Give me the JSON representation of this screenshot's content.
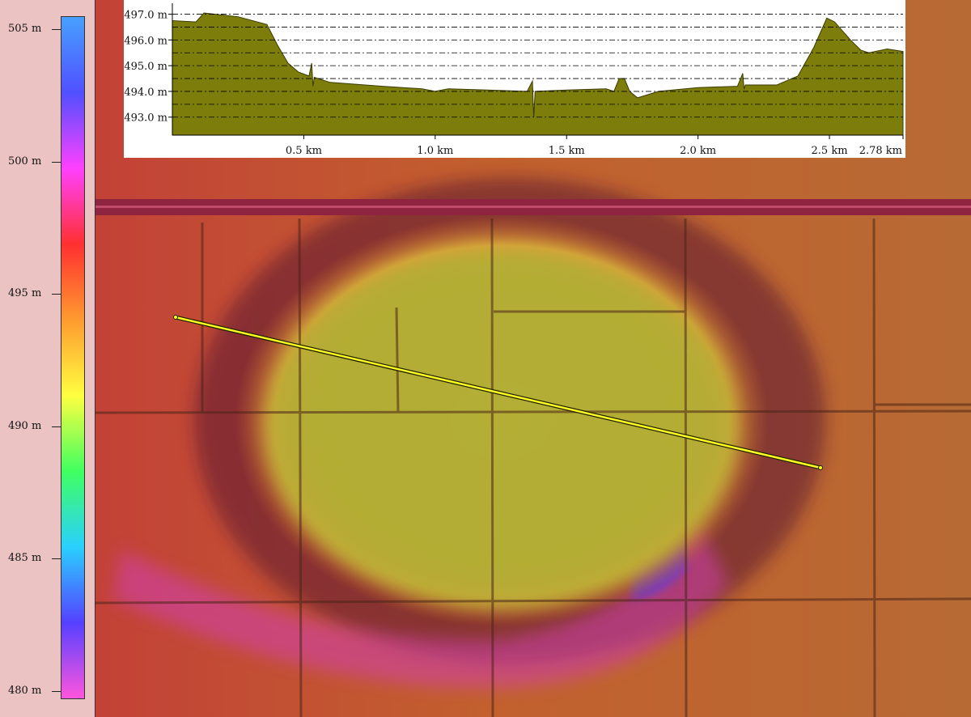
{
  "legend": {
    "labels": [
      "505 m",
      "500 m",
      "495 m",
      "490 m",
      "485 m",
      "480 m"
    ],
    "values": [
      505,
      500,
      495,
      490,
      485,
      480
    ],
    "range": [
      480,
      505
    ],
    "color_stops": [
      "#ff55dd",
      "#5540ff",
      "#2ad0ff",
      "#40ff60",
      "#ffff40",
      "#ff9a30",
      "#ff3030",
      "#ff40ff",
      "#5050ff",
      "#48a0ff"
    ]
  },
  "profile": {
    "y_tick_labels": [
      "497.0 m",
      "496.0 m",
      "495.0 m",
      "494.0 m",
      "493.0 m"
    ],
    "x_tick_labels": [
      "0.5 km",
      "1.0 km",
      "1.5 km",
      "2.0 km",
      "2.5 km",
      "2.78 km"
    ],
    "fill_color": "#7d7d0c"
  },
  "chart_data": {
    "type": "area",
    "title": "",
    "xlabel": "",
    "ylabel": "",
    "x_unit": "km",
    "y_unit": "m",
    "xlim": [
      0,
      2.78
    ],
    "ylim": [
      492.3,
      497.3
    ],
    "x_ticks": [
      0.5,
      1.0,
      1.5,
      2.0,
      2.5,
      2.78
    ],
    "y_ticks": [
      497.0,
      496.0,
      495.0,
      494.0,
      493.0
    ],
    "grid": true,
    "series": [
      {
        "x": [
          0,
          0.09,
          0.12,
          0.25,
          0.36,
          0.4,
          0.44,
          0.48,
          0.52,
          0.53,
          0.535,
          0.54,
          0.6,
          0.8,
          0.95,
          1.0,
          1.05,
          1.2,
          1.35,
          1.37,
          1.375,
          1.38,
          1.5,
          1.65,
          1.68,
          1.7,
          1.72,
          1.74,
          1.77,
          1.85,
          2.0,
          2.15,
          2.17,
          2.175,
          2.18,
          2.3,
          2.38,
          2.44,
          2.49,
          2.52,
          2.58,
          2.62,
          2.65,
          2.72,
          2.78
        ],
        "y": [
          496.75,
          496.7,
          497.05,
          496.9,
          496.6,
          495.8,
          495.1,
          494.75,
          494.6,
          495.1,
          494.2,
          494.55,
          494.35,
          494.2,
          494.1,
          494.0,
          494.1,
          494.05,
          494.0,
          494.4,
          493.0,
          494.0,
          494.05,
          494.1,
          494.0,
          494.5,
          494.5,
          494.0,
          493.75,
          494.0,
          494.15,
          494.2,
          494.7,
          494.1,
          494.25,
          494.25,
          494.6,
          495.7,
          496.85,
          496.7,
          496.0,
          495.6,
          495.5,
          495.65,
          495.55
        ]
      }
    ]
  },
  "map": {
    "transect_color": "#ffff20",
    "transect_start_km": 0,
    "transect_end_km": 2.78
  }
}
